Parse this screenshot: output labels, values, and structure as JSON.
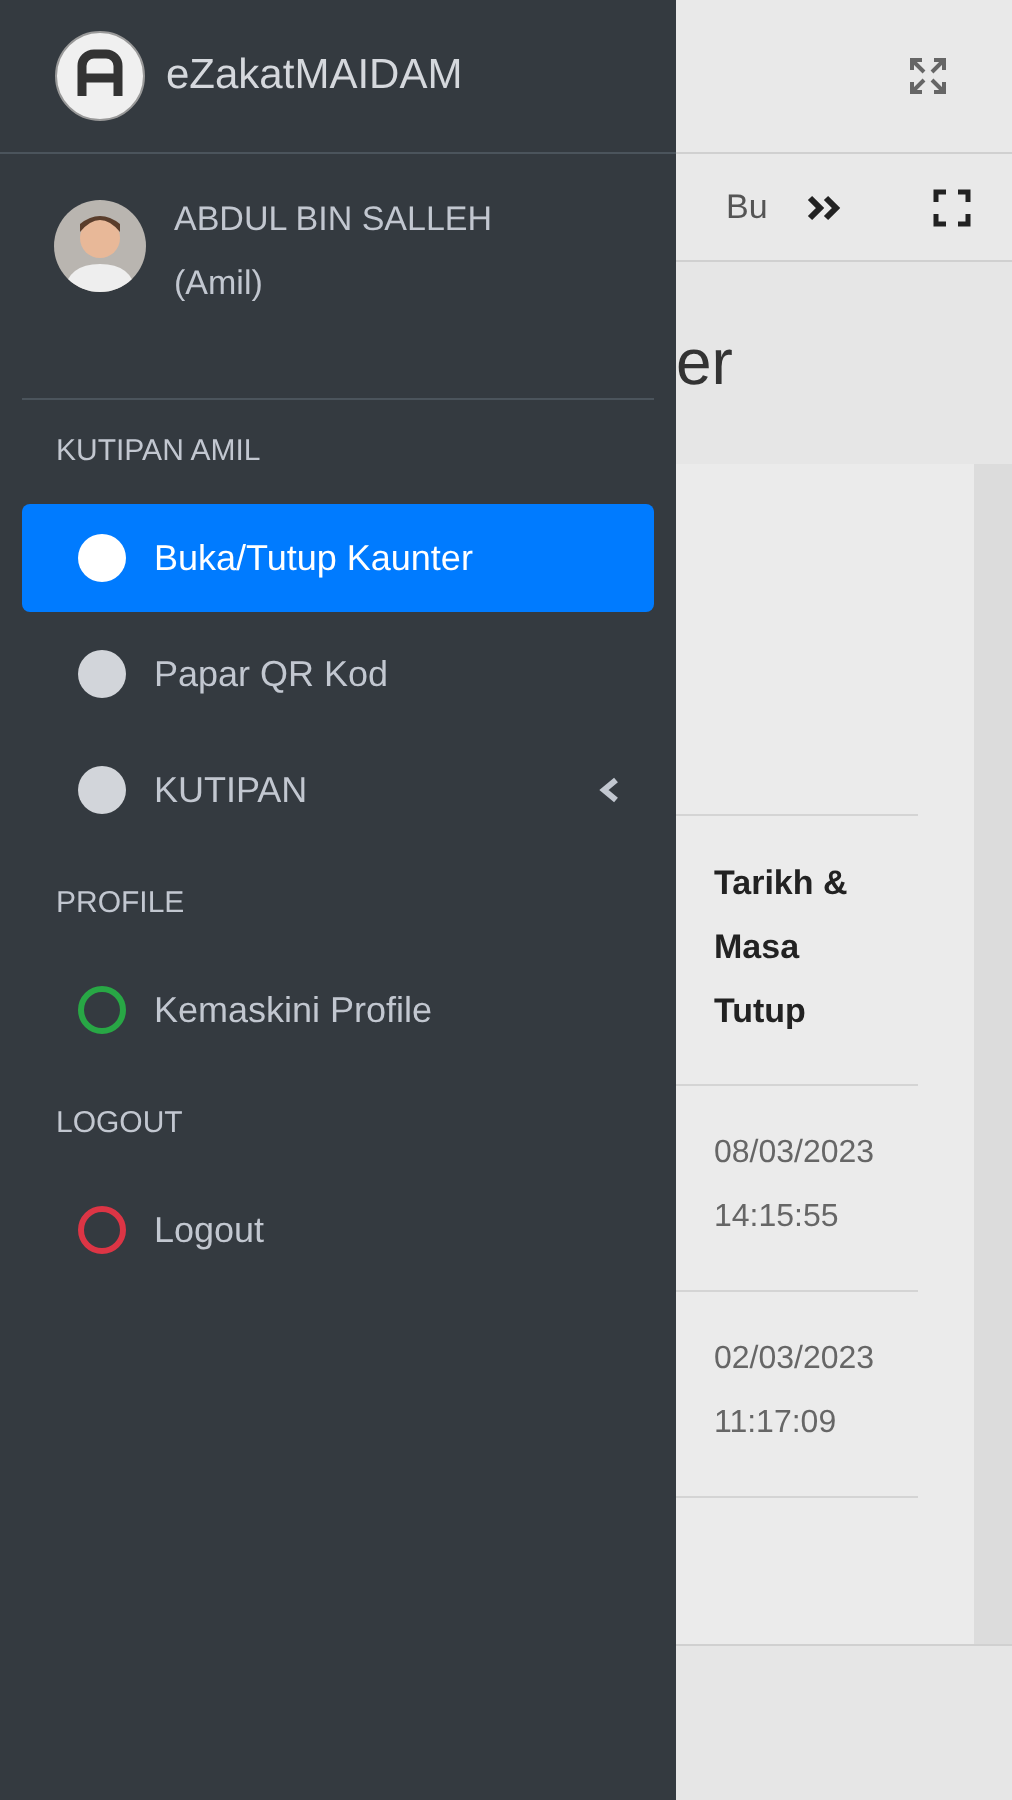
{
  "brand": {
    "title": "eZakatMAIDAM"
  },
  "user": {
    "name": "ABDUL BIN SALLEH",
    "role": "(Amil)"
  },
  "nav": [
    {
      "header": "KUTIPAN AMIL",
      "items": [
        {
          "label": "Buka/Tutup Kaunter",
          "selected": true,
          "kind": "dot",
          "color": "#ffffff"
        },
        {
          "label": "Papar QR Kod",
          "selected": false,
          "kind": "dot",
          "color": "#d2d5da"
        },
        {
          "label": "KUTIPAN",
          "selected": false,
          "kind": "dot",
          "color": "#d2d5da",
          "expanded": false
        }
      ]
    },
    {
      "header": "PROFILE",
      "items": [
        {
          "label": "Kemaskini Profile",
          "selected": false,
          "kind": "ring",
          "color": "#28a745"
        }
      ]
    },
    {
      "header": "LOGOUT",
      "items": [
        {
          "label": "Logout",
          "selected": false,
          "kind": "ring",
          "color": "#dc3545"
        }
      ]
    }
  ],
  "page": {
    "toolbar_text": "Bu",
    "heading": "er",
    "table": {
      "columns": [
        "Tarikh & Masa Tutup"
      ],
      "rows": [
        [
          "08/03/2023 14:15:55"
        ],
        [
          "02/03/2023 11:17:09"
        ]
      ]
    }
  }
}
